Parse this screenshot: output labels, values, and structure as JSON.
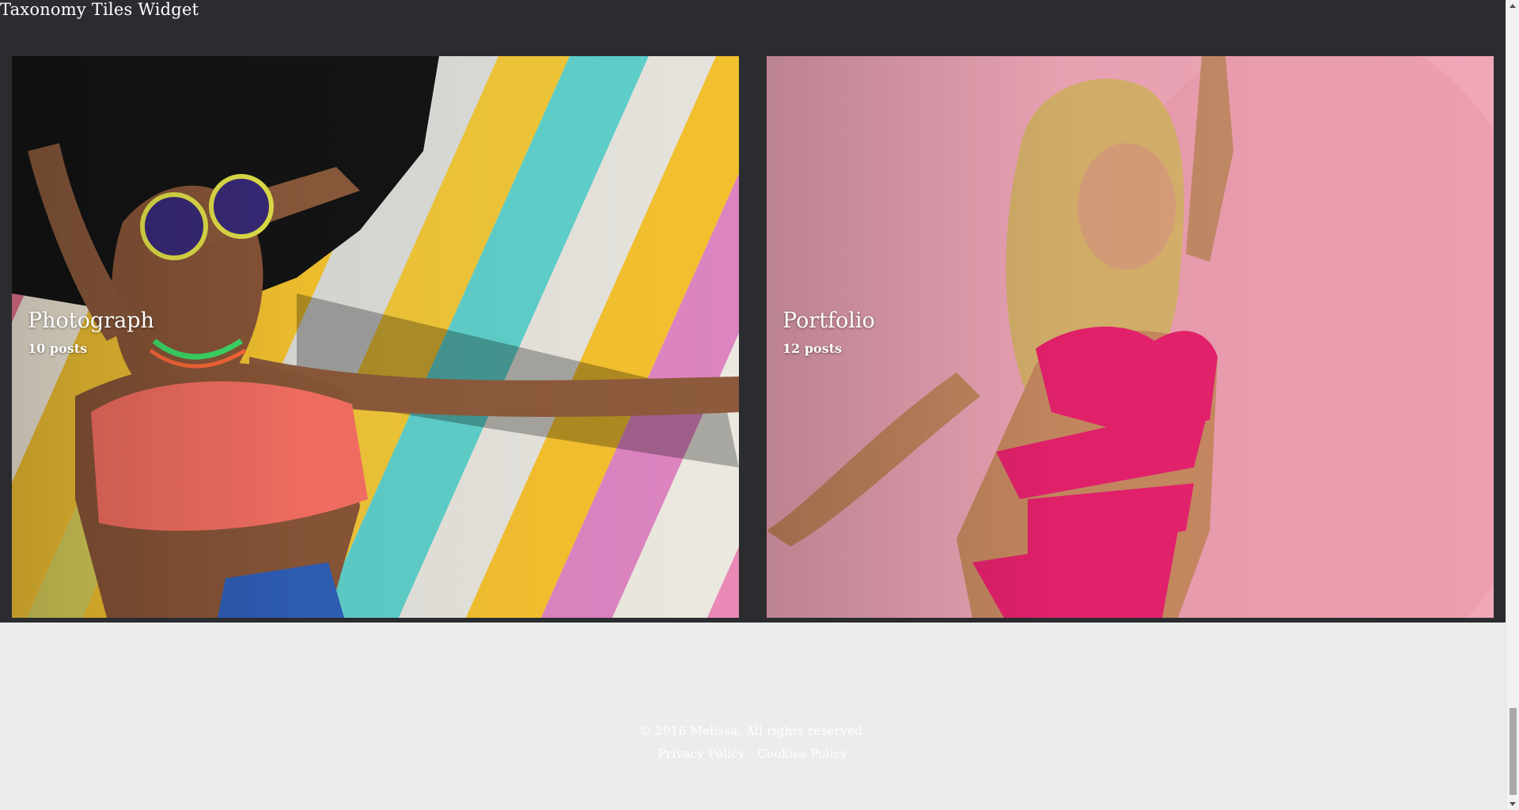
{
  "widget": {
    "title": "Taxonomy Tiles Widget",
    "tiles": [
      {
        "name": "Photograph",
        "count": "10 posts"
      },
      {
        "name": "Portfolio",
        "count": "12 posts"
      }
    ]
  },
  "footer": {
    "copyright": "© 2016 Melissa. All rights reserved.",
    "privacy_link": "Privacy Policy",
    "separator": "-",
    "cookies_link": "Cookies Policy"
  },
  "colors": {
    "widget_background": "#2b2c30",
    "page_background": "#ececec",
    "text": "#ffffff",
    "tile_1_accent": "#f5c431",
    "tile_2_background": "#f0a7b8"
  }
}
